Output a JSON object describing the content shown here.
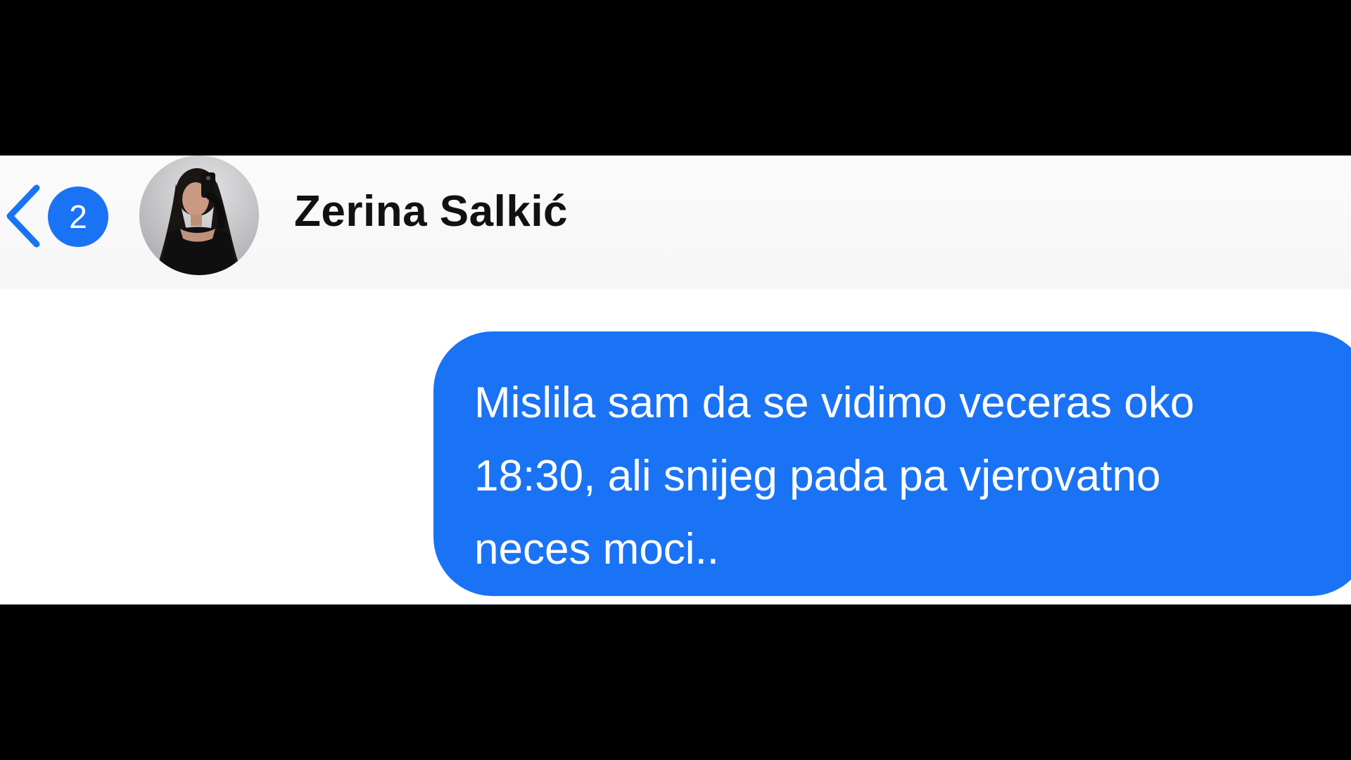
{
  "conversation": {
    "back_badge_count": "2",
    "contact_name": "Zerina Salkić",
    "accent_color": "#1a73f5"
  },
  "icons": {
    "back": "chevron-left-icon",
    "avatar": "profile-photo"
  },
  "messages": [
    {
      "direction": "outgoing",
      "lines": [
        "Mislila sam da se vidimo veceras oko",
        "18:30, ali snijeg pada pa vjerovatno",
        "neces moci.."
      ]
    }
  ]
}
